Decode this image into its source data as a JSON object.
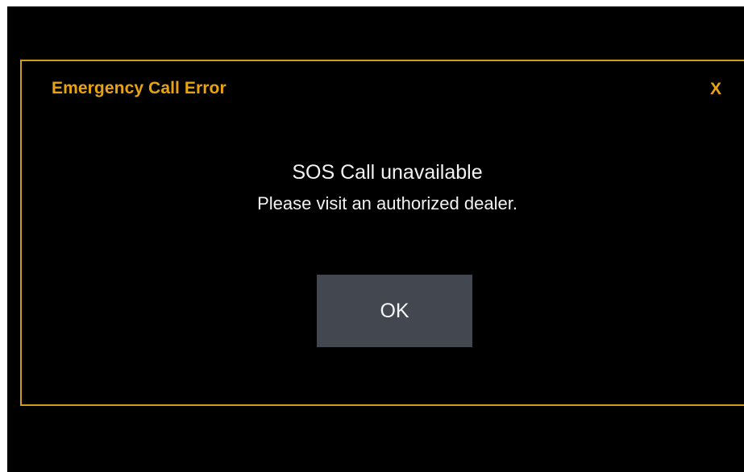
{
  "dialog": {
    "title": "Emergency Call Error",
    "close_label": "X",
    "message_primary": "SOS Call unavailable",
    "message_secondary": "Please visit an authorized dealer.",
    "ok_label": "OK"
  },
  "colors": {
    "background": "#000000",
    "accent": "#e9a310",
    "border": "#d39a1c",
    "button_bg": "#434750",
    "text": "#f2f2f2"
  },
  "icons": {
    "close": "close-icon"
  }
}
